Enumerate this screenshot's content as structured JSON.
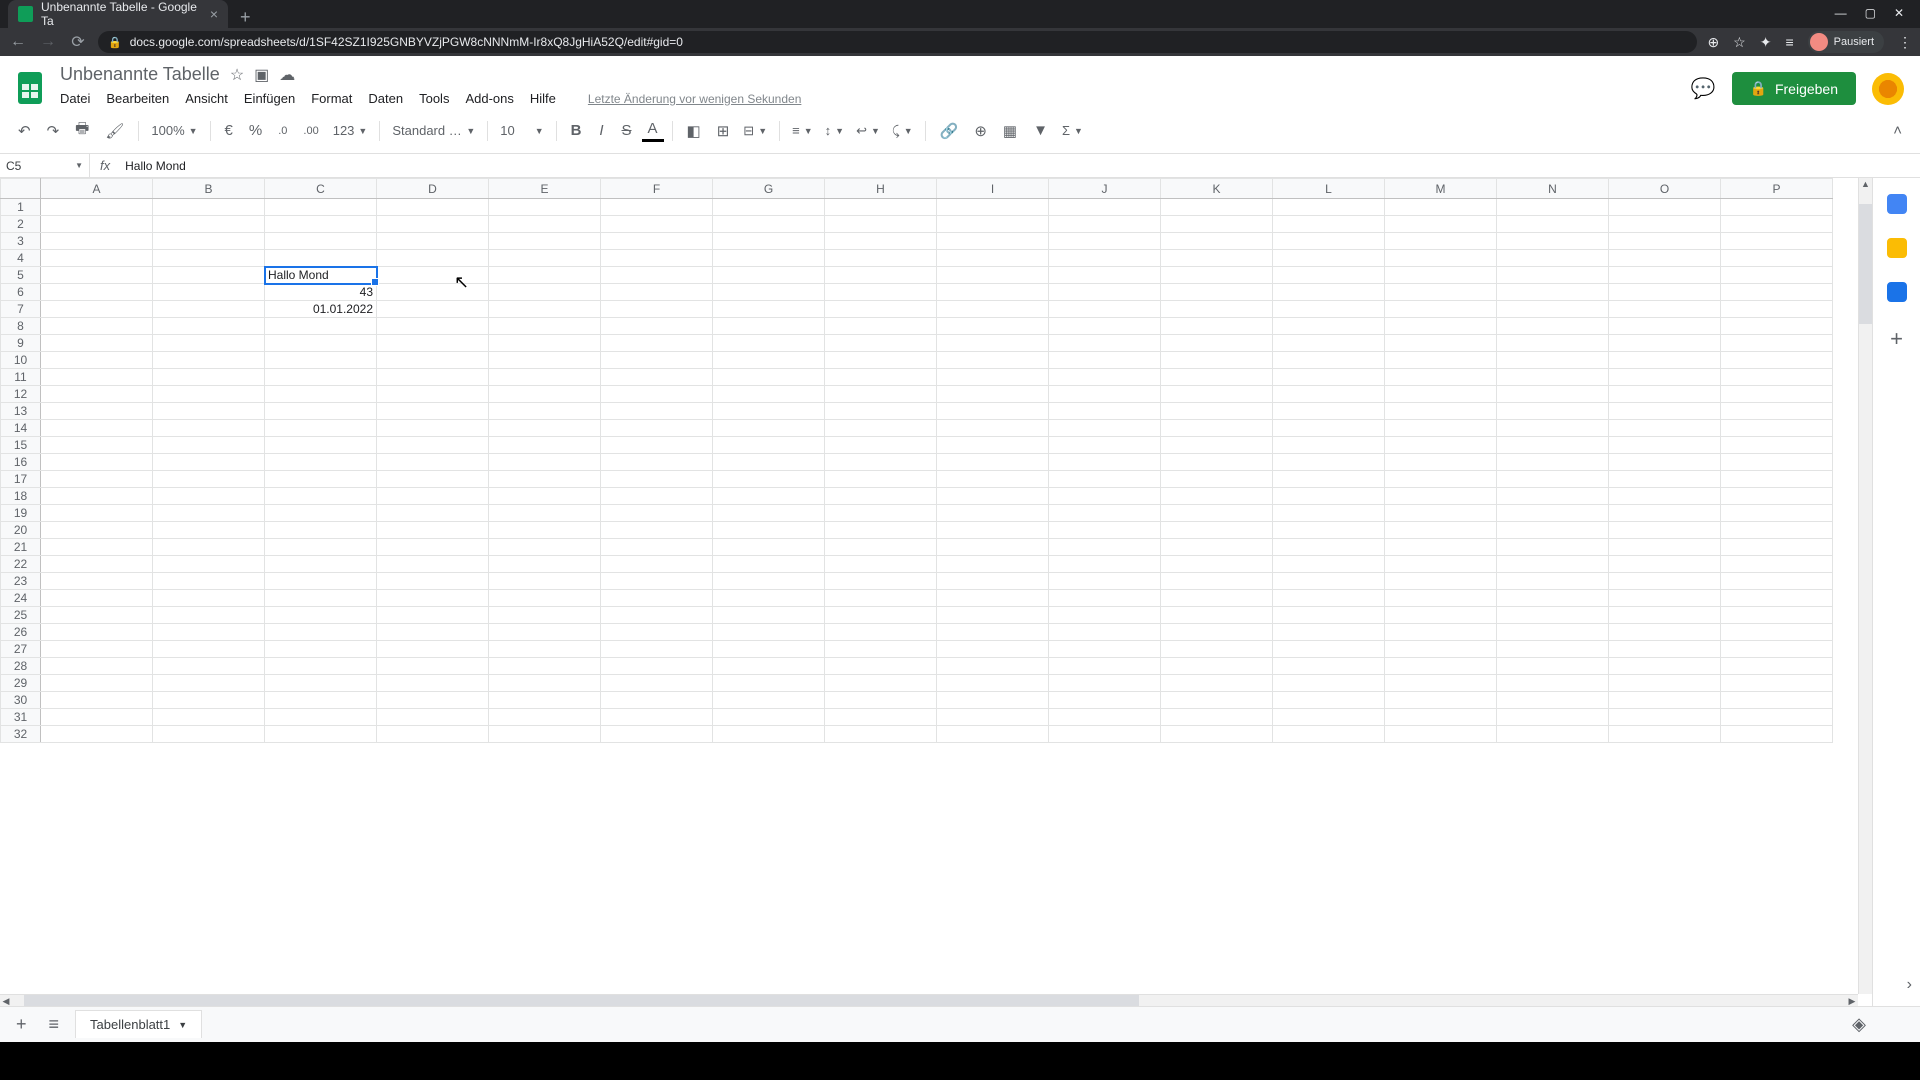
{
  "browser": {
    "tab_title": "Unbenannte Tabelle - Google Ta",
    "url": "docs.google.com/spreadsheets/d/1SF42SZ1I925GNBYVZjPGW8cNNNmM-Ir8xQ8JgHiA52Q/edit#gid=0",
    "profile_status": "Pausiert"
  },
  "doc": {
    "title": "Unbenannte Tabelle",
    "last_edit": "Letzte Änderung vor wenigen Sekunden"
  },
  "menus": {
    "file": "Datei",
    "edit": "Bearbeiten",
    "view": "Ansicht",
    "insert": "Einfügen",
    "format": "Format",
    "data": "Daten",
    "tools": "Tools",
    "addons": "Add-ons",
    "help": "Hilfe"
  },
  "share": {
    "label": "Freigeben"
  },
  "toolbar": {
    "zoom": "100%",
    "currency": "€",
    "percent": "%",
    "dec_less": ".0",
    "dec_more": ".00",
    "num_format": "123",
    "font": "Standard (...",
    "font_size": "10"
  },
  "name_box": "C5",
  "formula_value": "Hallo Mond",
  "columns": [
    "A",
    "B",
    "C",
    "D",
    "E",
    "F",
    "G",
    "H",
    "I",
    "J",
    "K",
    "L",
    "M",
    "N",
    "O",
    "P"
  ],
  "row_count": 32,
  "cells": {
    "C5": {
      "value": "Hallo Mond",
      "align": "l",
      "selected": true
    },
    "C6": {
      "value": "43",
      "align": "r"
    },
    "C7": {
      "value": "01.01.2022",
      "align": "r"
    }
  },
  "sheet_tab": "Tabellenblatt1"
}
